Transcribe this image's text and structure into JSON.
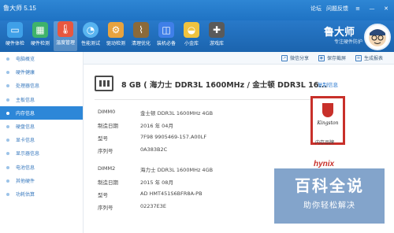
{
  "window": {
    "title": "鲁大师 5.15"
  },
  "titlebar": {
    "forum": "论坛",
    "feedback": "问题反馈",
    "menu_icon": "menu-icon",
    "minimize": "—",
    "close": "✕"
  },
  "toolbar": {
    "tools": [
      {
        "label": "硬件体检",
        "icon": "monitor-icon",
        "color": "#3fa0e8"
      },
      {
        "label": "硬件检测",
        "icon": "chip-icon",
        "color": "#3fb36b"
      },
      {
        "label": "温度管理",
        "icon": "thermometer-icon",
        "color": "#e8573f"
      },
      {
        "label": "性能测试",
        "icon": "speedometer-icon",
        "color": "#58b4f0"
      },
      {
        "label": "驱动检测",
        "icon": "gear-icon",
        "color": "#e8a33f"
      },
      {
        "label": "清理优化",
        "icon": "broom-icon",
        "color": "#8b6a3b"
      },
      {
        "label": "装机必备",
        "icon": "apps-icon",
        "color": "#3f7fe8"
      },
      {
        "label": "小金库",
        "icon": "gold-ingot-icon",
        "color": "#f0c33f"
      },
      {
        "label": "游戏库",
        "icon": "gamepad-icon",
        "color": "#5a5a5a"
      }
    ],
    "brand": "鲁大师",
    "brand_sub": "专注硬件防护"
  },
  "sidebar": {
    "items": [
      {
        "label": "电脑概览"
      },
      {
        "label": "硬件健康"
      },
      {
        "label": "处理器信息"
      },
      {
        "label": "主板信息"
      },
      {
        "label": "内存信息",
        "active": true
      },
      {
        "label": "硬盘信息"
      },
      {
        "label": "显卡信息"
      },
      {
        "label": "显示器信息"
      },
      {
        "label": "电池信息"
      },
      {
        "label": "其他硬件"
      },
      {
        "label": "功耗估算"
      }
    ]
  },
  "actions": {
    "share": "微信分享",
    "screenshot": "保存截屏",
    "report": "生成报表"
  },
  "memory": {
    "summary": "8 GB ( 海力士 DDR3L 1600MHz / 金士顿 DDR3L 16...",
    "copy": "复制信息",
    "labels": {
      "dimm0": "DIMM0",
      "dimm2": "DIMM2",
      "date": "制造日期",
      "model": "型号",
      "serial": "序列号"
    },
    "dimm0": {
      "desc": "金士顿 DDR3L 1600MHz 4GB",
      "date": "2016 年 04月",
      "model": "7F98 9905469-157.A00LF",
      "serial": "0A383B2C"
    },
    "dimm2": {
      "desc": "海力士 DDR3L 1600MHz 4GB",
      "date": "2015 年 08月",
      "model": "AD HMT451S6BFR8A-PB",
      "serial": "02237E3E"
    },
    "brand_label": "内存品牌",
    "kingston_logo": "Kingston",
    "hynix_logo": "hynix"
  },
  "watermark": {
    "big": "百科全说",
    "small": "助你轻松解决"
  }
}
